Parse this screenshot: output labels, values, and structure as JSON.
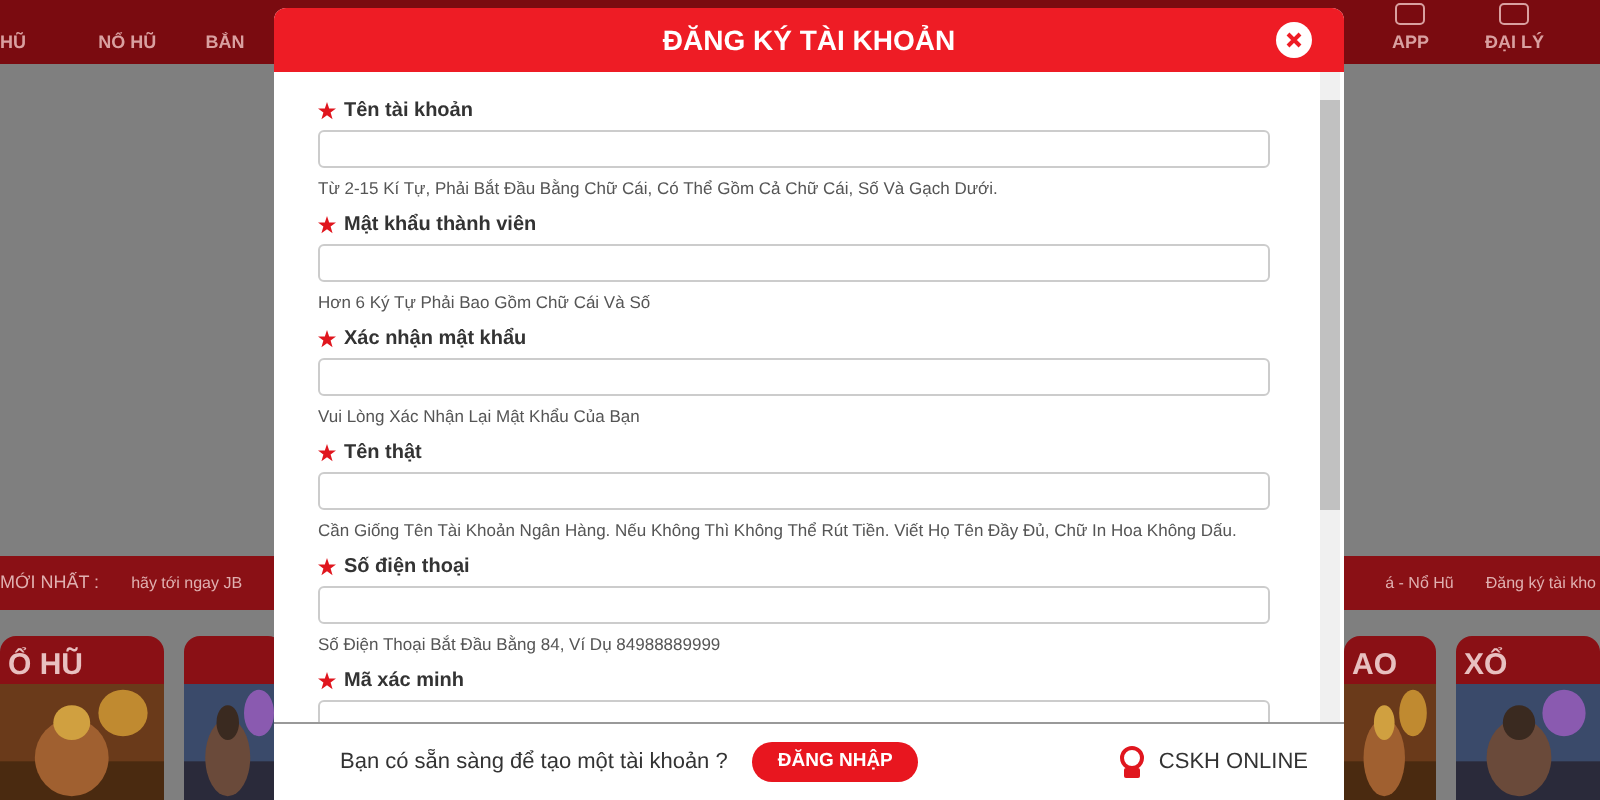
{
  "nav": {
    "items": [
      {
        "label": "HŨ"
      },
      {
        "label": "NỔ HŨ"
      },
      {
        "label": "BẮN"
      },
      {
        "label": "APP"
      },
      {
        "label": "ĐẠI LÝ"
      }
    ]
  },
  "ticker": {
    "label": "MỚI NHẤT :",
    "texts": [
      "hãy tới ngay JB",
      "á - Nổ Hũ",
      "Đăng ký tài kho"
    ]
  },
  "cards": [
    {
      "kind": "titled",
      "title": "Ổ HŨ"
    },
    {
      "kind": "plain"
    },
    {
      "kind": "titled",
      "title": "AO"
    },
    {
      "kind": "titled",
      "title": "XỔ"
    }
  ],
  "modal": {
    "title": "ĐĂNG KÝ TÀI KHOẢN",
    "fields": [
      {
        "label": "Tên tài khoản",
        "hint": "Từ 2-15 Kí Tự, Phải Bắt Đầu Bằng Chữ Cái, Có Thể Gồm Cả Chữ Cái, Số Và Gạch Dưới."
      },
      {
        "label": "Mật khẩu thành viên",
        "hint": "Hơn 6 Ký Tự Phải Bao Gồm Chữ Cái Và Số"
      },
      {
        "label": "Xác nhận mật khẩu",
        "hint": "Vui Lòng Xác Nhận Lại Mật Khẩu Của Bạn"
      },
      {
        "label": "Tên thật",
        "hint": "Cần Giống Tên Tài Khoản Ngân Hàng. Nếu Không Thì Không Thể Rút Tiền. Viết Họ Tên Đầy Đủ, Chữ In Hoa Không Dấu."
      },
      {
        "label": "Số điện thoại",
        "hint": "Số Điện Thoại Bắt Đầu Bằng 84, Ví Dụ 84988889999"
      },
      {
        "label": "Mã xác minh"
      }
    ],
    "prompt": "Bạn có sẵn sàng để tạo một tài khoản ?",
    "login_button": "ĐĂNG NHẬP",
    "support": "CSKH ONLINE"
  }
}
